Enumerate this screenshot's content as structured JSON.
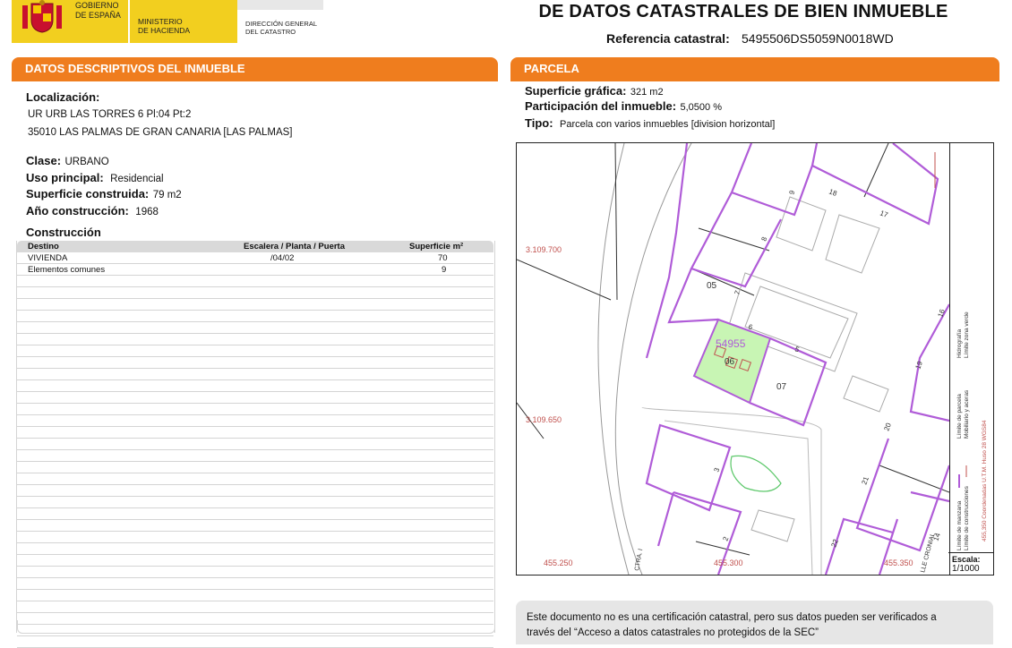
{
  "header": {
    "gobierno": [
      "GOBIERNO",
      "DE ESPAÑA"
    ],
    "ministerio": [
      "MINISTERIO",
      "DE HACIENDA"
    ],
    "direccion": [
      "DIRECCIÓN GENERAL",
      "DEL CATASTRO"
    ],
    "title": "DE DATOS CATASTRALES DE BIEN INMUEBLE",
    "ref_label": "Referencia catastral:",
    "ref_value": "5495506DS5059N0018WD"
  },
  "left": {
    "section_prefix": "DATOS DESCRIPTIVOS DEL ",
    "section_bold": "INMUEBLE",
    "localizacion_label": "Localización:",
    "address_line1": "UR URB LAS TORRES 6 Pl:04 Pt:2",
    "address_line2": "35010 LAS PALMAS DE GRAN CANARIA [LAS PALMAS]",
    "clase_label": "Clase:",
    "clase_value": "URBANO",
    "uso_label": "Uso principal:",
    "uso_value": "Residencial",
    "superficie_label": "Superficie construida:",
    "superficie_value": "79 m2",
    "anio_label": "Año construcción:",
    "anio_value": "1968",
    "construccion_label": "Construcción",
    "table_headers": {
      "destino": "Destino",
      "escalera": "Escalera / Planta / Puerta",
      "superficie": "Superficie m²"
    },
    "rows": [
      {
        "destino": "VIVIENDA",
        "escalera": "/04/02",
        "superficie": "70"
      },
      {
        "destino": "Elementos comunes",
        "escalera": "",
        "superficie": "9"
      }
    ]
  },
  "right": {
    "section_title": "PARCELA",
    "sup_label": "Superficie gráfica:",
    "sup_value": "321 m2",
    "part_label": "Participación del inmueble:",
    "part_value": "5,0500 %",
    "tipo_label": "Tipo:",
    "tipo_value": "Parcela con varios inmuebles [division horizontal]"
  },
  "map": {
    "parcel_id": "54955",
    "parcels": [
      "05",
      "06",
      "07"
    ],
    "street_numbers": [
      "9",
      "18",
      "17",
      "8",
      "7",
      "6",
      "5",
      "16",
      "19",
      "20",
      "21",
      "22",
      "14",
      "3",
      "2"
    ],
    "coord_y": [
      "3.109.700",
      "3.109.650"
    ],
    "coord_x": [
      "455.250",
      "455.300",
      "455.350"
    ],
    "street_labels": [
      "CTRA. I",
      "LLE CRONIAL"
    ],
    "legend": [
      "Límite de manzana",
      "Límite de parcela",
      "Límite de construcciones",
      "Mobiliario y aceras",
      "Límite zona verde",
      "Hidrografía"
    ],
    "coord_note": "455,350 Coordenadas U.T.M. Huso 28 WGS84",
    "escala_label": "Escala:",
    "escala_value": "1/1000"
  },
  "notice": {
    "line1": "Este documento no es una certificación catastral, pero sus datos pueden ser verificados a",
    "line2": "través del “Acceso a datos catastrales no protegidos de la SEC”"
  },
  "colors": {
    "orange": "#ef7d1e",
    "yellow": "#f2cf1f",
    "purple": "#b05cd8",
    "green": "#c8f5b4",
    "red_text": "#c0504d"
  }
}
